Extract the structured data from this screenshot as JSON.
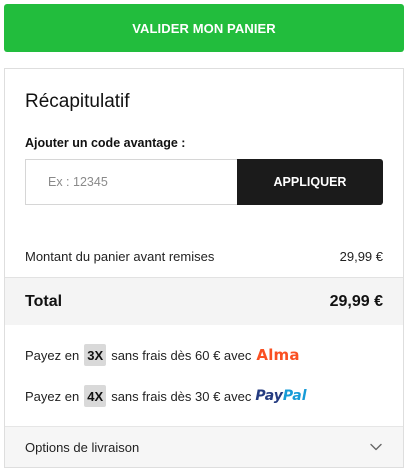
{
  "cart": {
    "validate_label": "VALIDER MON PANIER"
  },
  "summary": {
    "title": "Récapitulatif",
    "promo": {
      "label": "Ajouter un code avantage :",
      "placeholder": "Ex : 12345",
      "value": "",
      "apply_label": "APPLIQUER"
    },
    "subtotal": {
      "label": "Montant du panier avant remises",
      "value": "29,99 €"
    },
    "total": {
      "label": "Total",
      "value": "29,99 €"
    },
    "installments": [
      {
        "prefix": "Payez en",
        "count": "3X",
        "suffix": "sans frais dès 60 € avec",
        "provider": "Alma",
        "provider_color": "#fa5022"
      },
      {
        "prefix": "Payez en",
        "count": "4X",
        "suffix": "sans frais dès 30 € avec",
        "provider_part1": "Pay",
        "provider_part2": "Pal",
        "provider_colors": [
          "#253b80",
          "#179bd7"
        ]
      }
    ],
    "delivery": {
      "label": "Options de livraison",
      "icon": "chevron-down-icon"
    }
  },
  "colors": {
    "accent_green": "#22bd3d",
    "button_dark": "#1b1b1b",
    "total_bg": "#f4f4f4"
  }
}
